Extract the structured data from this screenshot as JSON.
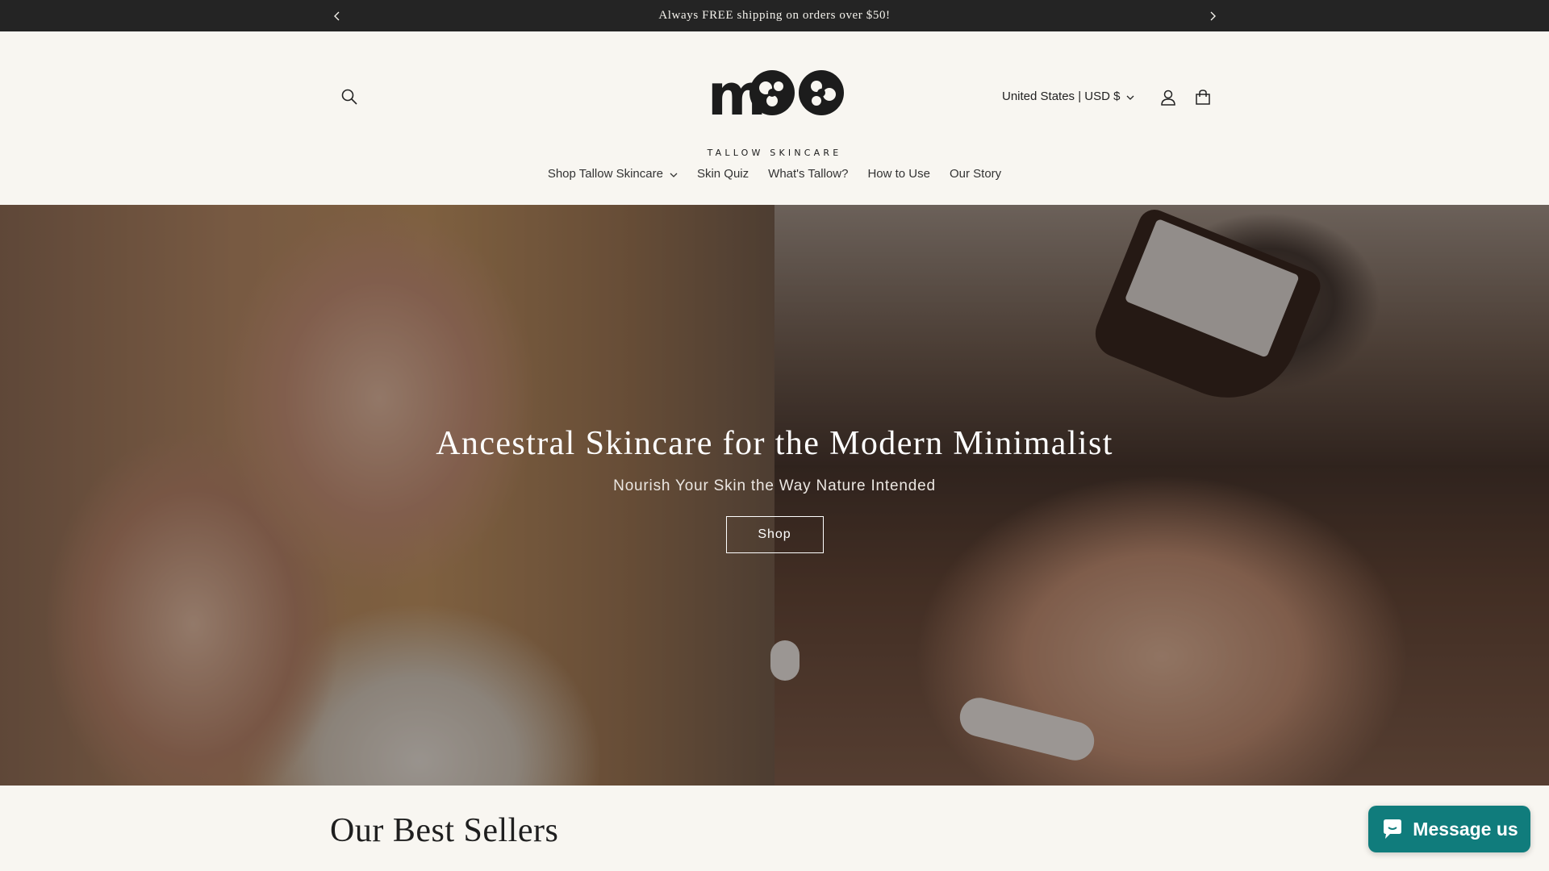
{
  "announcement": {
    "text": "Always FREE shipping on orders over $50!",
    "prev_icon": "chevron-left-icon",
    "next_icon": "chevron-right-icon"
  },
  "header": {
    "logo_text": "moo",
    "logo_subtitle": "TALLOW SKINCARE",
    "country_selector": "United States | USD $",
    "search_icon": "search-icon",
    "account_icon": "user-icon",
    "cart_icon": "cart-icon"
  },
  "nav": {
    "items": [
      {
        "label": "Shop Tallow Skincare",
        "has_dropdown": true
      },
      {
        "label": "Skin Quiz"
      },
      {
        "label": "What's Tallow?"
      },
      {
        "label": "How to Use"
      },
      {
        "label": "Our Story"
      }
    ]
  },
  "hero": {
    "title": "Ancestral Skincare for the Modern Minimalist",
    "subtitle": "Nourish Your Skin the Way Nature Intended",
    "button_label": "Shop"
  },
  "best_sellers": {
    "title": "Our Best Sellers"
  },
  "chat_widget": {
    "label": "Message us",
    "icon": "chat-bubble-icon",
    "color": "#107c7c"
  },
  "colors": {
    "announcement_bg": "#242424",
    "page_bg": "#f8f6f1"
  }
}
